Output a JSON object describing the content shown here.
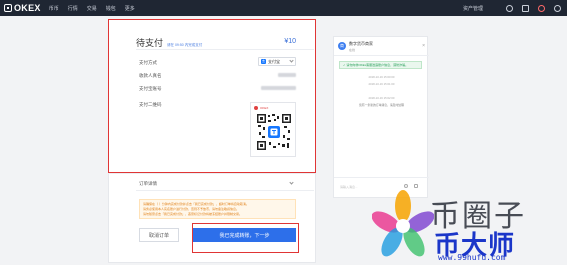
{
  "topbar": {
    "logo": "OKEX",
    "nav": [
      "币币",
      "行情",
      "交易",
      "钱包",
      "更多"
    ],
    "account": "资产管理"
  },
  "payment": {
    "title": "待支付",
    "subtitle": "请在 09:50 内完成支付",
    "amount": "¥10",
    "method_label": "支付方式",
    "method_value": "支付宝",
    "payee_label": "收款人真名",
    "account_label": "支付宝账号",
    "qr_label": "支付二维码",
    "qr_head": "OKEX"
  },
  "order": {
    "title": "订单详情",
    "notices": [
      "请确保在（   ）分钟内完成付款并点击「我已完成付款」，超时订单将自动取消。",
      "请务必使用本人实名账户进行付款，否则不予放币，请勿备注敏感信息。",
      "请勿随意点击「我已完成付款」，恶意标记付款将被冻结账户并限制交易。"
    ],
    "cancel_label": "取消订单",
    "done_label": "我已完成转账，下一步"
  },
  "chat": {
    "name": "数字货币商家",
    "name_sub": "在线",
    "close": "×",
    "alert": "✓ 请勿向非OKEx客服透露账户信息，谨防诈骗。",
    "lines": [
      "2018-10-16 15:00:00",
      "2018-10-16 15:01:00",
      "2018-10-16 15:02:00",
      "您有一条新的订单消息，请及时处理"
    ],
    "input_placeholder": "请输入消息..."
  },
  "watermark": {
    "top": "币圈子",
    "big": "币大师",
    "url": "www.99hufu.com"
  },
  "colors": {
    "accent": "#2d6fea",
    "highlight": "#e03535",
    "topbar": "#1f2633"
  }
}
